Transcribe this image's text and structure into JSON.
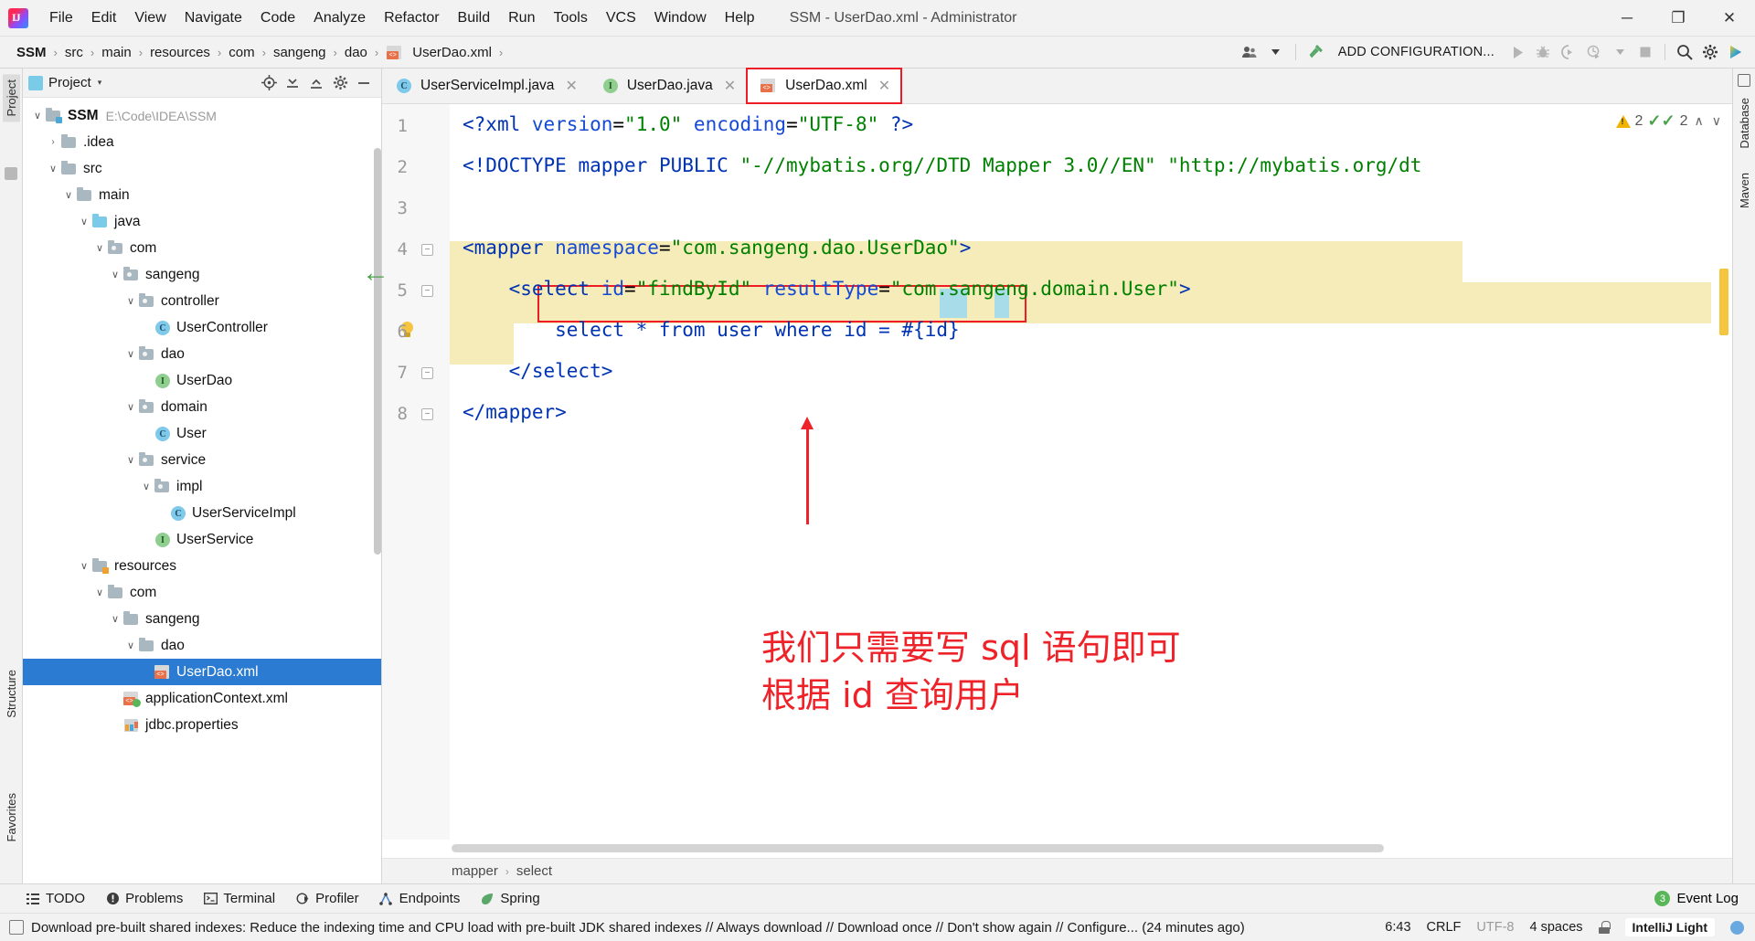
{
  "window": {
    "title": "SSM - UserDao.xml - Administrator",
    "controls": {
      "minimize": "─",
      "maximize": "❐",
      "close": "✕"
    }
  },
  "menubar": {
    "items": [
      "File",
      "Edit",
      "View",
      "Navigate",
      "Code",
      "Analyze",
      "Refactor",
      "Build",
      "Run",
      "Tools",
      "VCS",
      "Window",
      "Help"
    ]
  },
  "navbar": {
    "breadcrumbs": [
      "SSM",
      "src",
      "main",
      "resources",
      "com",
      "sangeng",
      "dao",
      "UserDao.xml"
    ],
    "separator": "›",
    "add_configuration": "ADD CONFIGURATION...",
    "icons": [
      "user-group-icon",
      "hammer-icon",
      "run-icon",
      "debug-icon",
      "coverage-icon",
      "profile-icon",
      "dropdown-icon",
      "stop-icon",
      "search-everywhere-icon",
      "settings-icon",
      "updates-icon"
    ]
  },
  "left_rail": {
    "tabs": [
      "Project",
      "Structure",
      "Favorites"
    ],
    "active": "Project"
  },
  "right_rail": {
    "tabs": [
      "Database",
      "Maven"
    ]
  },
  "project_panel": {
    "title": "Project",
    "caret": "▾",
    "actions": [
      "locate-icon",
      "collapse-all-icon",
      "expand-all-icon",
      "settings-icon",
      "hide-icon"
    ],
    "tree": [
      {
        "label": "SSM",
        "path": "E:\\Code\\IDEA\\SSM",
        "depth": 0,
        "arrow": "⌄",
        "icon": "module-folder-icon",
        "bold": true
      },
      {
        "label": ".idea",
        "depth": 1,
        "arrow": "›",
        "icon": "folder-icon"
      },
      {
        "label": "src",
        "depth": 1,
        "arrow": "⌄",
        "icon": "folder-icon"
      },
      {
        "label": "main",
        "depth": 2,
        "arrow": "⌄",
        "icon": "folder-icon"
      },
      {
        "label": "java",
        "depth": 3,
        "arrow": "⌄",
        "icon": "source-root-folder-icon"
      },
      {
        "label": "com",
        "depth": 4,
        "arrow": "⌄",
        "icon": "package-folder-icon"
      },
      {
        "label": "sangeng",
        "depth": 5,
        "arrow": "⌄",
        "icon": "package-folder-icon"
      },
      {
        "label": "controller",
        "depth": 6,
        "arrow": "⌄",
        "icon": "package-folder-icon"
      },
      {
        "label": "UserController",
        "depth": 7,
        "arrow": "",
        "icon": "java-class-icon"
      },
      {
        "label": "dao",
        "depth": 6,
        "arrow": "⌄",
        "icon": "package-folder-icon"
      },
      {
        "label": "UserDao",
        "depth": 7,
        "arrow": "",
        "icon": "java-interface-icon"
      },
      {
        "label": "domain",
        "depth": 6,
        "arrow": "⌄",
        "icon": "package-folder-icon"
      },
      {
        "label": "User",
        "depth": 7,
        "arrow": "",
        "icon": "java-class-icon"
      },
      {
        "label": "service",
        "depth": 6,
        "arrow": "⌄",
        "icon": "package-folder-icon"
      },
      {
        "label": "impl",
        "depth": 7,
        "arrow": "⌄",
        "icon": "package-folder-icon"
      },
      {
        "label": "UserServiceImpl",
        "depth": 8,
        "arrow": "",
        "icon": "java-class-icon"
      },
      {
        "label": "UserService",
        "depth": 7,
        "arrow": "",
        "icon": "java-interface-icon"
      },
      {
        "label": "resources",
        "depth": 3,
        "arrow": "⌄",
        "icon": "resource-root-folder-icon"
      },
      {
        "label": "com",
        "depth": 4,
        "arrow": "⌄",
        "icon": "folder-icon"
      },
      {
        "label": "sangeng",
        "depth": 5,
        "arrow": "⌄",
        "icon": "folder-icon"
      },
      {
        "label": "dao",
        "depth": 6,
        "arrow": "⌄",
        "icon": "folder-icon"
      },
      {
        "label": "UserDao.xml",
        "depth": 7,
        "arrow": "",
        "icon": "xml-file-icon",
        "selected": true
      },
      {
        "label": "applicationContext.xml",
        "depth": 5,
        "arrow": "",
        "icon": "spring-xml-file-icon"
      },
      {
        "label": "jdbc.properties",
        "depth": 5,
        "arrow": "",
        "icon": "properties-file-icon"
      }
    ]
  },
  "editor": {
    "tabs": [
      {
        "label": "UserServiceImpl.java",
        "icon": "java-class-icon",
        "active": false,
        "close": "✕"
      },
      {
        "label": "UserDao.java",
        "icon": "java-interface-icon",
        "active": false,
        "close": "✕"
      },
      {
        "label": "UserDao.xml",
        "icon": "xml-file-icon",
        "active": true,
        "highlighted": true,
        "close": "✕"
      }
    ],
    "line_numbers": [
      "1",
      "2",
      "3",
      "4",
      "5",
      "6",
      "7",
      "8"
    ],
    "lines": [
      {
        "n": 1,
        "segments": [
          {
            "t": "<?",
            "c": "tag"
          },
          {
            "t": "xml ",
            "c": "tag"
          },
          {
            "t": "version",
            "c": "attr"
          },
          {
            "t": "=",
            "c": "plain"
          },
          {
            "t": "\"1.0\"",
            "c": "val"
          },
          {
            "t": " ",
            "c": "plain"
          },
          {
            "t": "encoding",
            "c": "attr"
          },
          {
            "t": "=",
            "c": "plain"
          },
          {
            "t": "\"UTF-8\"",
            "c": "val"
          },
          {
            "t": " ",
            "c": "plain"
          },
          {
            "t": "?>",
            "c": "tag"
          }
        ]
      },
      {
        "n": 2,
        "segments": [
          {
            "t": "<!DOCTYPE ",
            "c": "tag"
          },
          {
            "t": "mapper ",
            "c": "blue"
          },
          {
            "t": "PUBLIC ",
            "c": "blue"
          },
          {
            "t": "\"-//mybatis.org//DTD Mapper 3.0//EN\"",
            "c": "val"
          },
          {
            "t": " ",
            "c": "plain"
          },
          {
            "t": "\"http://mybatis.org/dt",
            "c": "val"
          }
        ]
      },
      {
        "n": 3,
        "segments": []
      },
      {
        "n": 4,
        "segments": [
          {
            "t": "<mapper ",
            "c": "tag"
          },
          {
            "t": "namespace",
            "c": "attr"
          },
          {
            "t": "=",
            "c": "plain"
          },
          {
            "t": "\"com.sangeng.dao.UserDao\"",
            "c": "val"
          },
          {
            "t": ">",
            "c": "tag"
          }
        ]
      },
      {
        "n": 5,
        "segments": [
          {
            "t": "    ",
            "c": "plain"
          },
          {
            "t": "<select ",
            "c": "tag"
          },
          {
            "t": "id",
            "c": "attr"
          },
          {
            "t": "=",
            "c": "plain"
          },
          {
            "t": "\"findById\"",
            "c": "val"
          },
          {
            "t": " ",
            "c": "plain"
          },
          {
            "t": "resultType",
            "c": "attr"
          },
          {
            "t": "=",
            "c": "plain"
          },
          {
            "t": "\"com.sangeng.domain.User\"",
            "c": "val"
          },
          {
            "t": ">",
            "c": "tag"
          }
        ]
      },
      {
        "n": 6,
        "segments": [
          {
            "t": "        select * from user where id = #{id}",
            "c": "blue"
          }
        ]
      },
      {
        "n": 7,
        "segments": [
          {
            "t": "    ",
            "c": "plain"
          },
          {
            "t": "</select>",
            "c": "tag"
          }
        ]
      },
      {
        "n": 8,
        "segments": [
          {
            "t": "</mapper>",
            "c": "tag"
          }
        ]
      }
    ],
    "inspection": {
      "warnings": "2",
      "checks": "2",
      "up": "∧",
      "down": "∨"
    },
    "breadcrumb": [
      "mapper",
      "select"
    ],
    "breadcrumb_sep": "›"
  },
  "annotation": {
    "line1": "我们只需要写 sql 语句即可",
    "line2": "根据 id 查询用户",
    "color": "#ee2229"
  },
  "toolwindow_bar": {
    "items": [
      {
        "label": "TODO",
        "icon": "todo-icon"
      },
      {
        "label": "Problems",
        "icon": "problems-icon"
      },
      {
        "label": "Terminal",
        "icon": "terminal-icon"
      },
      {
        "label": "Profiler",
        "icon": "profiler-icon"
      },
      {
        "label": "Endpoints",
        "icon": "endpoints-icon"
      },
      {
        "label": "Spring",
        "icon": "spring-leaf-icon"
      }
    ],
    "event_log": {
      "label": "Event Log",
      "badge": "3"
    }
  },
  "statusbar": {
    "message": "Download pre-built shared indexes: Reduce the indexing time and CPU load with pre-built JDK shared indexes // Always download // Download once // Don't show again // Configure... (24 minutes ago)",
    "caret": "6:43",
    "line_separator": "CRLF",
    "encoding": "UTF-8",
    "indent": "4 spaces",
    "lock": "unlocked-icon",
    "theme": "IntelliJ Light"
  },
  "colors": {
    "accent_red": "#ee2229",
    "selection_blue": "#2a7bd1",
    "highlight_yellow": "#f6ecb9",
    "xml_tag": "#0033b3",
    "xml_value": "#008000",
    "green_arrow": "#4aa24a"
  }
}
